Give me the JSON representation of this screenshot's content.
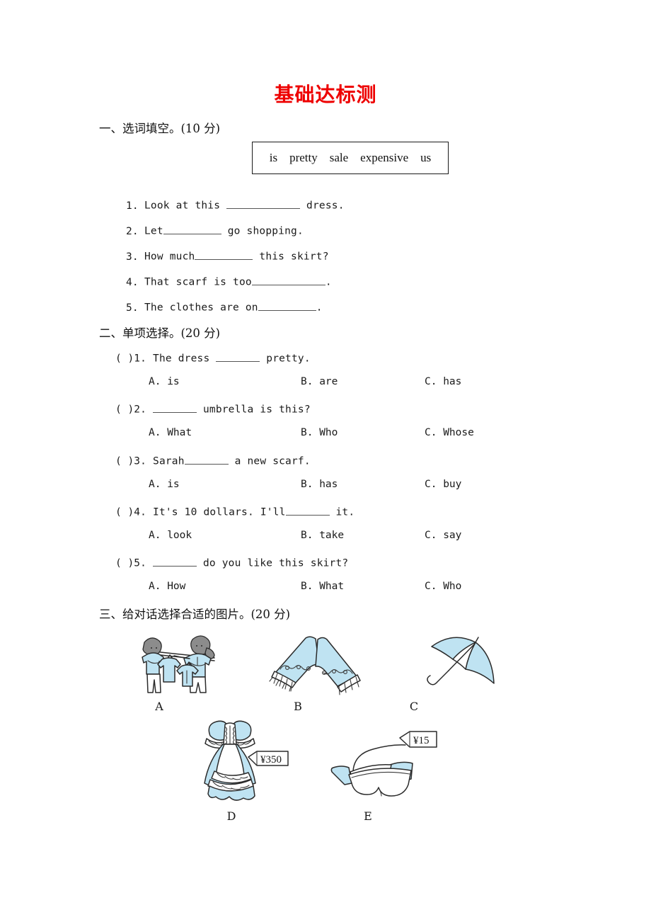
{
  "document": {
    "title": "基础达标测",
    "title_color": "#ee0000"
  },
  "section1": {
    "heading": "一、选词填空。(10 分)",
    "word_bank": [
      "is",
      "pretty",
      "sale",
      "expensive",
      "us"
    ],
    "items": [
      {
        "num": "1.",
        "before": "Look at this",
        "blank": "lg",
        "after": "dress."
      },
      {
        "num": "2.",
        "before": "Let",
        "blank": "md",
        "after": "go shopping."
      },
      {
        "num": "3.",
        "before": "How much",
        "blank": "md",
        "after": "this skirt?"
      },
      {
        "num": "4.",
        "before": "That scarf is too",
        "blank": "lg",
        "after": "."
      },
      {
        "num": "5.",
        "before": "The clothes are on",
        "blank": "md",
        "after": "."
      }
    ]
  },
  "section2": {
    "heading": "二、单项选择。(20 分)",
    "questions": [
      {
        "bracket": "(     )",
        "num": "1.",
        "before": "The dress",
        "blank": "md",
        "after": "pretty.",
        "options": [
          "A. is",
          "B. are",
          "C. has"
        ]
      },
      {
        "bracket": "(     )",
        "num": "2.",
        "before": "",
        "blank": "md",
        "after": "umbrella is this?",
        "options": [
          "A. What",
          "B. Who",
          "C. Whose"
        ]
      },
      {
        "bracket": "(     )",
        "num": "3.",
        "before": "Sarah",
        "blank": "md",
        "after": "a new scarf.",
        "options": [
          "A. is",
          "B. has",
          "C. buy"
        ]
      },
      {
        "bracket": "(     )",
        "num": "4.",
        "before": "It's 10 dollars. I'll",
        "blank": "md",
        "after": "it.",
        "options": [
          "A. look",
          "B. take",
          "C. say"
        ]
      },
      {
        "bracket": "(     )",
        "num": "5.",
        "before": "",
        "blank": "md",
        "after": "do you like this skirt?",
        "options": [
          "A. How",
          "B. What",
          "C. Who"
        ]
      }
    ]
  },
  "section3": {
    "heading": "三、给对话选择合适的图片。(20 分)",
    "pictures": [
      {
        "label": "A",
        "subject": "two-people-shopping-clothes-rack"
      },
      {
        "label": "B",
        "subject": "blue-scarf-with-fringe"
      },
      {
        "label": "C",
        "subject": "blue-umbrella"
      },
      {
        "label": "D",
        "subject": "blue-dress-with-price-tag",
        "price": "¥350"
      },
      {
        "label": "E",
        "subject": "sunglasses-with-price-tag",
        "price": "¥15"
      }
    ]
  }
}
